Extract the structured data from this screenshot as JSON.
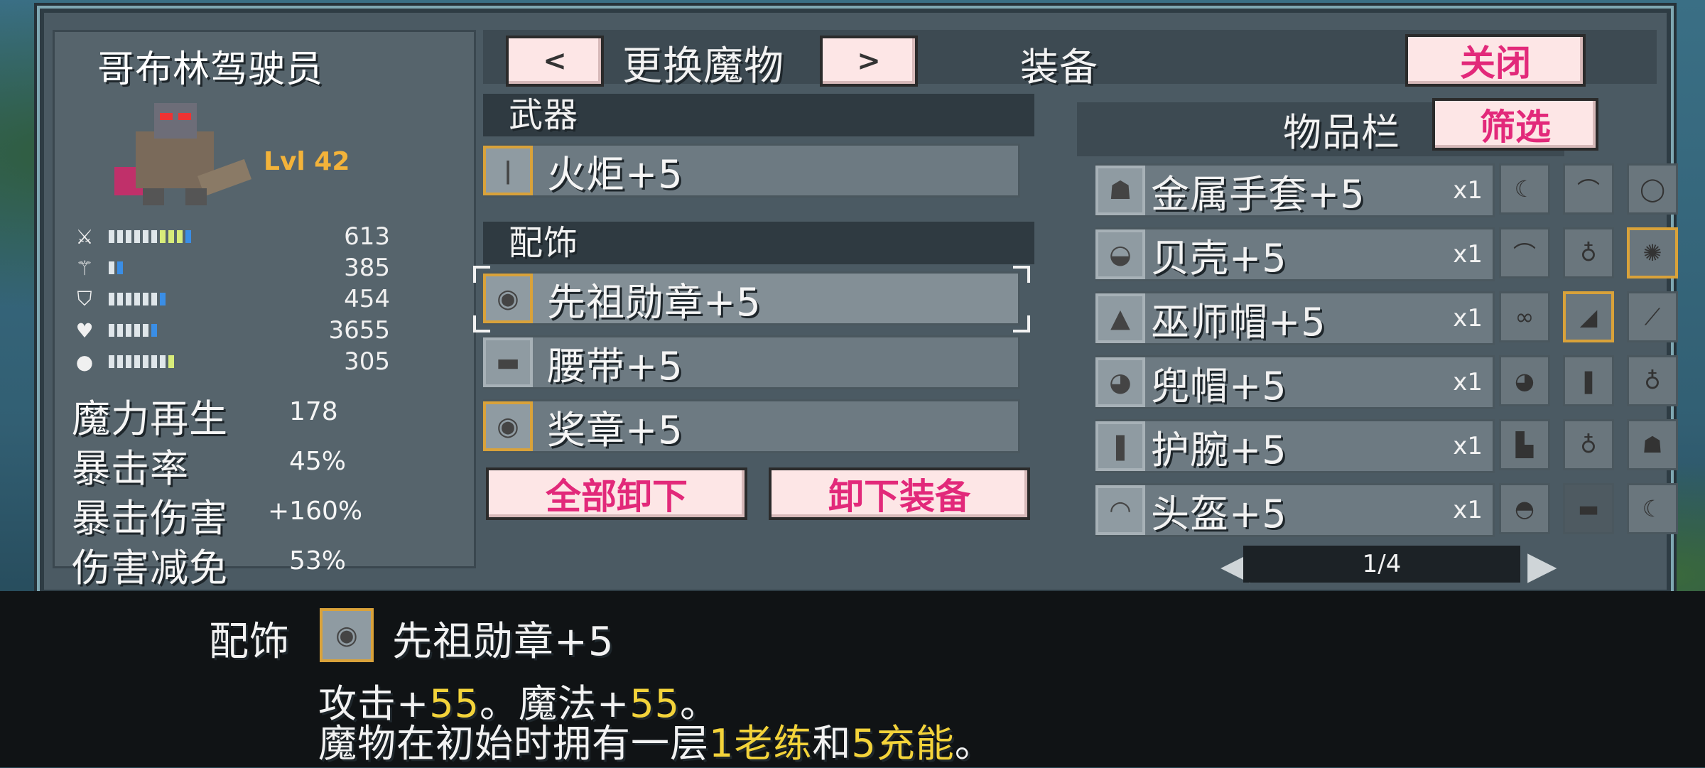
{
  "monster": {
    "name": "哥布林驾驶员",
    "level": "Lvl 42",
    "stats": [
      {
        "icon": "sword-icon",
        "value": "613",
        "fill": 0.8
      },
      {
        "icon": "wand-icon",
        "value": "385",
        "fill": 0.15
      },
      {
        "icon": "shield-icon",
        "value": "454",
        "fill": 0.55
      },
      {
        "icon": "heart-icon",
        "value": "3655",
        "fill": 0.5
      },
      {
        "icon": "potion-icon",
        "value": "305",
        "fill": 0.6
      }
    ],
    "mana_regen_label": "魔力再生",
    "mana_regen_value": "178",
    "crit_rate_label": "暴击率",
    "crit_rate_value": "45%",
    "crit_damage_label": "暴击伤害",
    "crit_damage_value": "+160%",
    "damage_reduction_label": "伤害减免",
    "damage_reduction_value": "53%"
  },
  "header": {
    "prev_label": "<",
    "change_monster": "更换魔物",
    "next_label": ">",
    "equipment_title": "装备",
    "close_label": "关闭"
  },
  "equipment": {
    "weapon_header": "武器",
    "weapon": "火炬+5",
    "accessory_header": "配饰",
    "accessories": [
      "先祖勋章+5",
      "腰带+5",
      "奖章+5"
    ],
    "unequip_all": "全部卸下",
    "unequip": "卸下装备"
  },
  "inventory": {
    "title": "物品栏",
    "filter": "筛选",
    "items": [
      {
        "name": "金属手套+5",
        "qty": "x1"
      },
      {
        "name": "贝壳+5",
        "qty": "x1"
      },
      {
        "name": "巫师帽+5",
        "qty": "x1"
      },
      {
        "name": "兜帽+5",
        "qty": "x1"
      },
      {
        "name": "护腕+5",
        "qty": "x1"
      },
      {
        "name": "头盔+5",
        "qty": "x1"
      }
    ],
    "page": "1/4"
  },
  "tooltip": {
    "category": "配饰",
    "name": "先祖勋章+5",
    "line1_a": "攻击+",
    "line1_b": "55",
    "line1_c": "。魔法+",
    "line1_d": "55",
    "line1_e": "。",
    "line2_a": "魔物在初始时拥有一层",
    "line2_b": "1老练",
    "line2_c": "和",
    "line2_d": "5充能",
    "line2_e": "。"
  },
  "colors": {
    "highlight": "#d9a23a",
    "accent_pink": "#e2297a",
    "level": "#f3b33a",
    "value_yellow": "#f3d33a"
  }
}
